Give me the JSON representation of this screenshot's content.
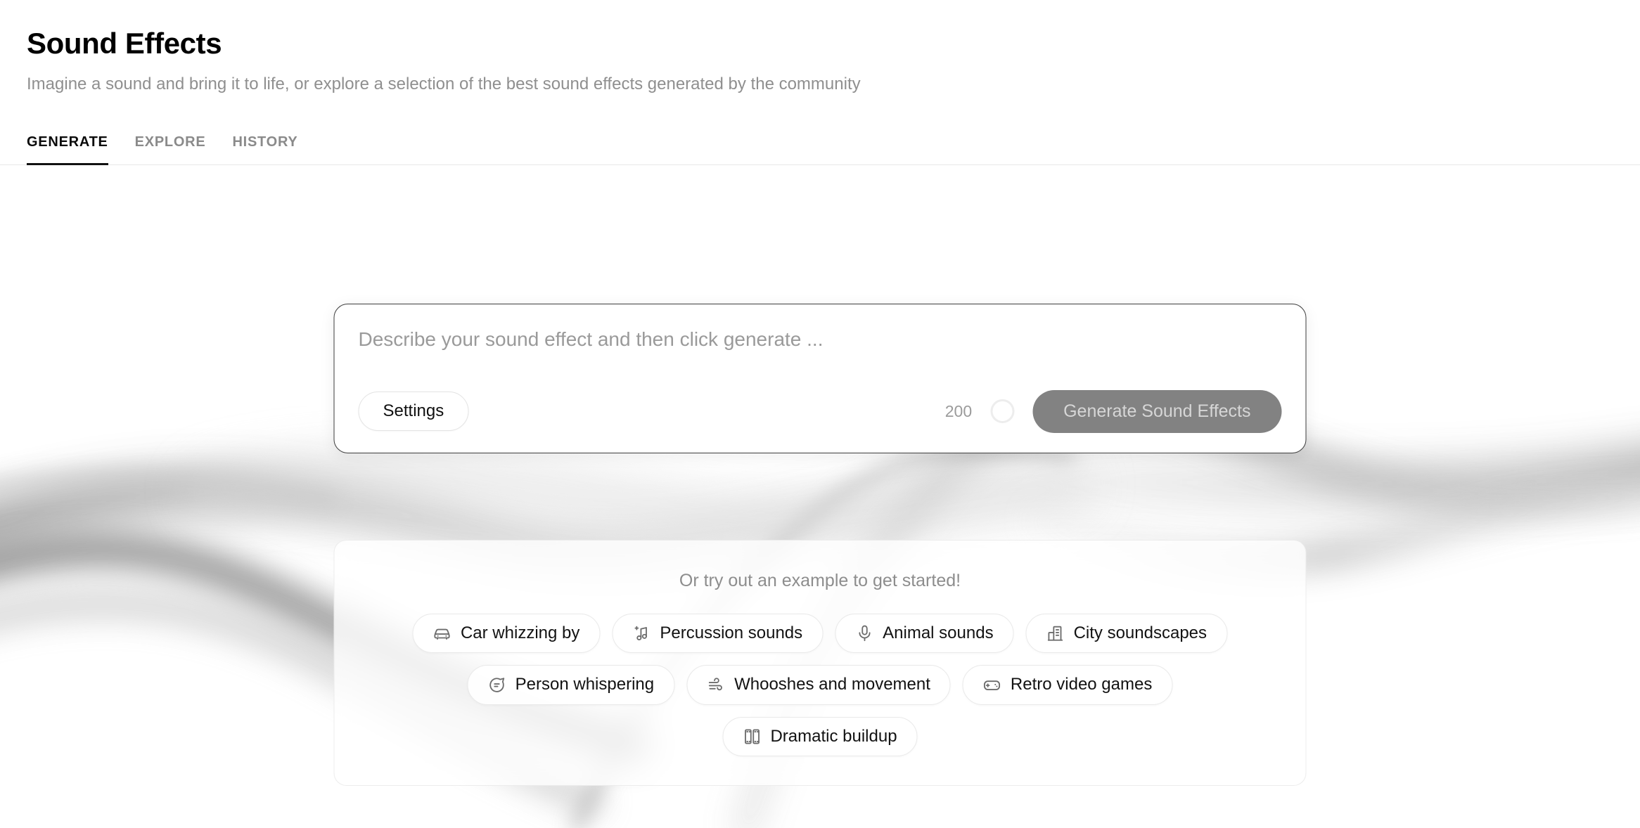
{
  "header": {
    "title": "Sound Effects",
    "subtitle": "Imagine a sound and bring it to life, or explore a selection of the best sound effects generated by the community"
  },
  "tabs": [
    {
      "label": "GENERATE",
      "active": true
    },
    {
      "label": "EXPLORE",
      "active": false
    },
    {
      "label": "HISTORY",
      "active": false
    }
  ],
  "prompt_card": {
    "input_value": "",
    "placeholder": "Describe your sound effect and then click generate ...",
    "settings_label": "Settings",
    "char_count": "200",
    "credit_ring_icon": "circle-progress-icon",
    "generate_label": "Generate Sound Effects",
    "generate_disabled": true
  },
  "examples": {
    "title": "Or try out an example to get started!",
    "rows": [
      [
        {
          "label": "Car whizzing by",
          "icon": "car-icon"
        },
        {
          "label": "Percussion sounds",
          "icon": "music-note-plus-icon"
        },
        {
          "label": "Animal sounds",
          "icon": "microphone-icon"
        },
        {
          "label": "City soundscapes",
          "icon": "buildings-icon"
        }
      ],
      [
        {
          "label": "Person whispering",
          "icon": "speech-bubble-icon"
        },
        {
          "label": "Whooshes and movement",
          "icon": "wind-icon"
        },
        {
          "label": "Retro video games",
          "icon": "gamepad-icon"
        }
      ],
      [
        {
          "label": "Dramatic buildup",
          "icon": "film-strip-icon"
        }
      ]
    ]
  },
  "colors": {
    "accent": "#111111",
    "muted_text": "#8f8f8f",
    "generate_button_bg": "#828282",
    "generate_button_text": "#d6d6d6",
    "card_border": "#3d3d3d",
    "page_bg": "#ffffff"
  }
}
